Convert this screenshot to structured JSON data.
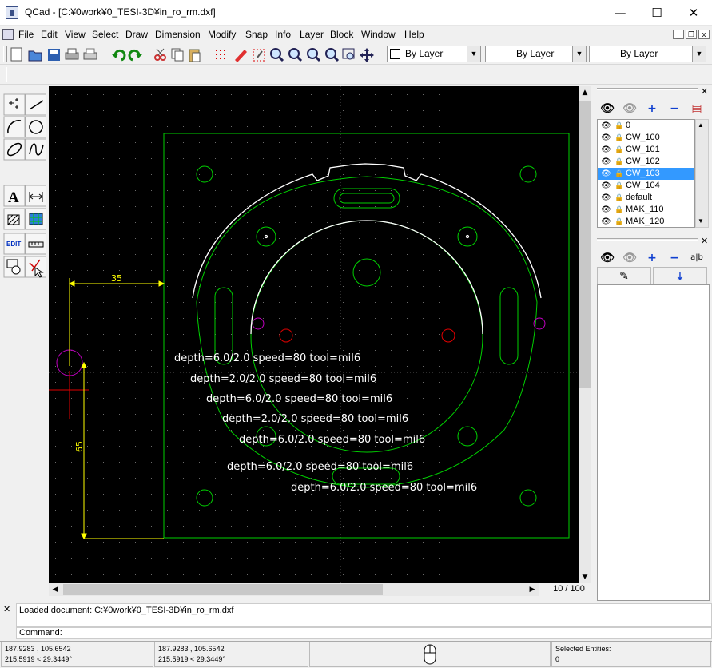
{
  "window": {
    "title": "QCad - [C:¥0work¥0_TESI-3D¥in_ro_rm.dxf]",
    "minimize": "—",
    "maximize": "☐",
    "close": "✕"
  },
  "menu": [
    "File",
    "Edit",
    "View",
    "Select",
    "Draw",
    "Dimension",
    "Modify",
    "Snap",
    "Info",
    "Layer",
    "Block",
    "Window",
    "Help"
  ],
  "mdi_controls": {
    "min": "_",
    "restore": "❐",
    "close": "x"
  },
  "toolbar": {
    "icons": [
      "new-icon",
      "open-icon",
      "save-icon",
      "print-icon",
      "print-preview-icon",
      "undo-icon",
      "redo-icon",
      "cut-icon",
      "copy-icon",
      "paste-icon",
      "grid-icon",
      "draft-icon",
      "redraw-icon",
      "zoom-in-icon",
      "zoom-out-icon",
      "zoom-auto-icon",
      "zoom-previous-icon",
      "zoom-window-icon",
      "zoom-pan-icon"
    ],
    "color_combo": "By Layer",
    "linetype_combo": "By Layer",
    "linewidth_combo": "By Layer"
  },
  "cad_tools": [
    [
      "points-tool-icon",
      "line-tool-icon"
    ],
    [
      "arc-tool-icon",
      "circle-tool-icon"
    ],
    [
      "ellipse-tool-icon",
      "spline-tool-icon"
    ],
    [
      "text-tool-icon",
      "dimension-tool-icon"
    ],
    [
      "hatch-tool-icon",
      "image-tool-icon"
    ],
    [
      "edit-tool-icon",
      "measure-tool-icon"
    ],
    [
      "select-tool-icon",
      "modify-tool-icon"
    ]
  ],
  "text_tool_glyph": "A",
  "edit_tool_label": "EDIT",
  "drawing": {
    "dim_horizontal": "35",
    "dim_vertical": "65",
    "notes": [
      "depth=6.0/2.0 speed=80 tool=mil6",
      "depth=2.0/2.0 speed=80 tool=mil6",
      "depth=6.0/2.0 speed=80 tool=mil6",
      "depth=2.0/2.0 speed=80 tool=mil6",
      "depth=6.0/2.0 speed=80 tool=mil6",
      "depth=6.0/2.0 speed=80 tool=mil6",
      "depth=6.0/2.0 speed=80 tool=mil6"
    ]
  },
  "page_counter": "10 / 100",
  "layers": {
    "items": [
      "0",
      "CW_100",
      "CW_101",
      "CW_102",
      "CW_103",
      "CW_104",
      "default",
      "MAK_110",
      "MAK_120"
    ],
    "selected": "CW_103",
    "buttons": {
      "show_all": "👁",
      "hide_all": "👁",
      "add": "+",
      "remove": "−",
      "edit": "▤"
    }
  },
  "blocks": {
    "buttons": {
      "show_all": "👁",
      "hide_all": "👁",
      "add": "+",
      "remove": "−",
      "rename": "a|b",
      "edit": "✎",
      "insert": "⤓"
    }
  },
  "command": {
    "history": "Loaded document: C:¥0work¥0_TESI-3D¥in_ro_rm.dxf",
    "label": "Command:"
  },
  "status": {
    "abs_coord": "187.9283 , 105.6542",
    "abs_polar": "215.5919 < 29.3449°",
    "rel_coord": "187.9283 , 105.6542",
    "rel_polar": "215.5919 < 29.3449°",
    "selected_label": "Selected Entities:",
    "selected_count": "0"
  },
  "colors": {
    "canvas": "#000000",
    "entity_green": "#00d000",
    "entity_white": "#ffffff",
    "dimension_yellow": "#ffff00",
    "marker_magenta": "#c000c0",
    "marker_red": "#e00000",
    "selection": "#3399ff"
  }
}
